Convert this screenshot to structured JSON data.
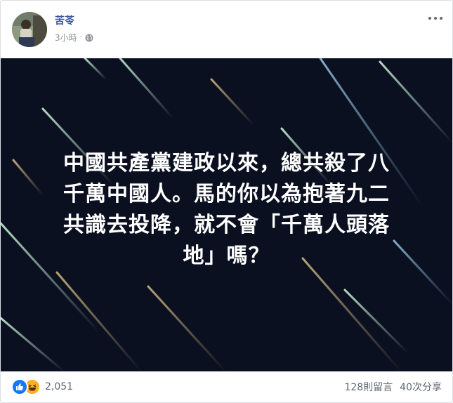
{
  "post": {
    "author": "苦苓",
    "timestamp": "3小時",
    "separator": "·",
    "privacy_icon": "globe-icon",
    "more_icon": "more-options-icon"
  },
  "image": {
    "background_color": "#0b1021",
    "text_lines": [
      "中國共產黨建政以來，總共殺了八",
      "千萬中國人。馬的你以為抱著九二",
      "共識去投降，就不會「千萬人頭落",
      "地」嗎？"
    ]
  },
  "footer": {
    "reaction_icons": [
      "like-icon",
      "haha-icon"
    ],
    "reaction_count": "2,051",
    "comments": "128則留言",
    "shares": "40次分享"
  },
  "colors": {
    "author_link": "#385898",
    "meta_text": "#90949c",
    "like": "#1877f2",
    "haha": "#f7b125"
  }
}
